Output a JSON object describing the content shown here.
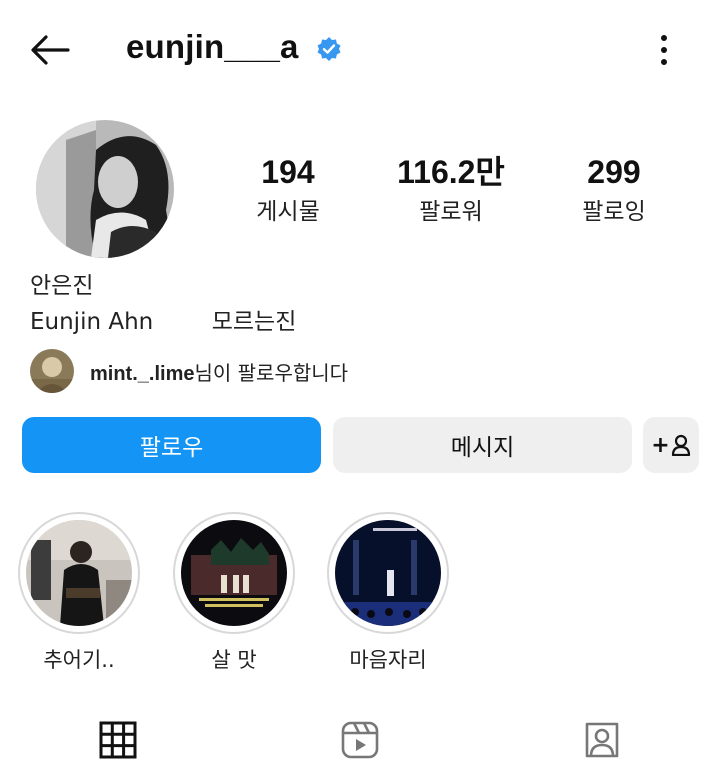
{
  "header": {
    "username": "eunjin___a",
    "verified": true,
    "back_icon": "arrow-left-icon",
    "more_icon": "more-vertical-icon"
  },
  "stats": [
    {
      "value": "194",
      "label": "게시물"
    },
    {
      "value": "116.2만",
      "label": "팔로워"
    },
    {
      "value": "299",
      "label": "팔로잉"
    }
  ],
  "profile": {
    "full_name": "안은진",
    "bio": "Eunjin Ahn        모르는진"
  },
  "followed_by": {
    "username": "mint._.lime",
    "suffix": "님이 팔로우합니다"
  },
  "buttons": {
    "follow": "팔로우",
    "message": "메시지",
    "add_user": "+",
    "add_user_icon": "person-add-icon"
  },
  "highlights": [
    {
      "label": "추어기.."
    },
    {
      "label": "살 맛"
    },
    {
      "label": "마음자리"
    }
  ],
  "tabs": [
    {
      "icon": "grid-icon",
      "active": true
    },
    {
      "icon": "reels-icon",
      "active": false
    },
    {
      "icon": "tagged-icon",
      "active": false
    }
  ],
  "colors": {
    "accent": "#1495f5",
    "verified": "#3897f0",
    "button_secondary": "#efefef"
  }
}
